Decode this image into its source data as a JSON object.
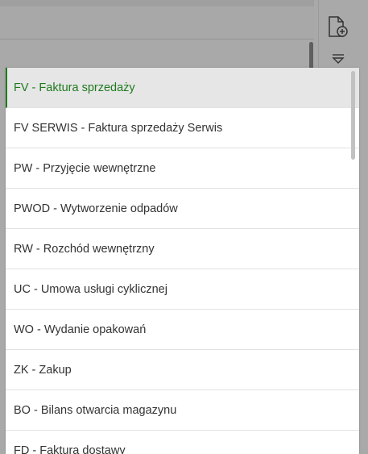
{
  "toolbar": {
    "new_document_icon": "file-plus-icon",
    "filter_icon": "filter-icon"
  },
  "document_types": {
    "selected_index": 0,
    "items": [
      {
        "label": "FV - Faktura sprzedaży"
      },
      {
        "label": "FV SERWIS - Faktura sprzedaży Serwis"
      },
      {
        "label": "PW - Przyjęcie wewnętrzne"
      },
      {
        "label": "PWOD - Wytworzenie odpadów"
      },
      {
        "label": "RW - Rozchód wewnętrzny"
      },
      {
        "label": "UC - Umowa usługi cyklicznej"
      },
      {
        "label": "WO - Wydanie opakowań"
      },
      {
        "label": "ZK - Zakup"
      },
      {
        "label": "BO - Bilans otwarcia magazynu"
      },
      {
        "label": "FD - Faktura dostawy"
      }
    ]
  },
  "colors": {
    "selected_text": "#1f7a1f",
    "selected_bg": "#e6e6e6",
    "overlay": "#a9a9a9"
  }
}
